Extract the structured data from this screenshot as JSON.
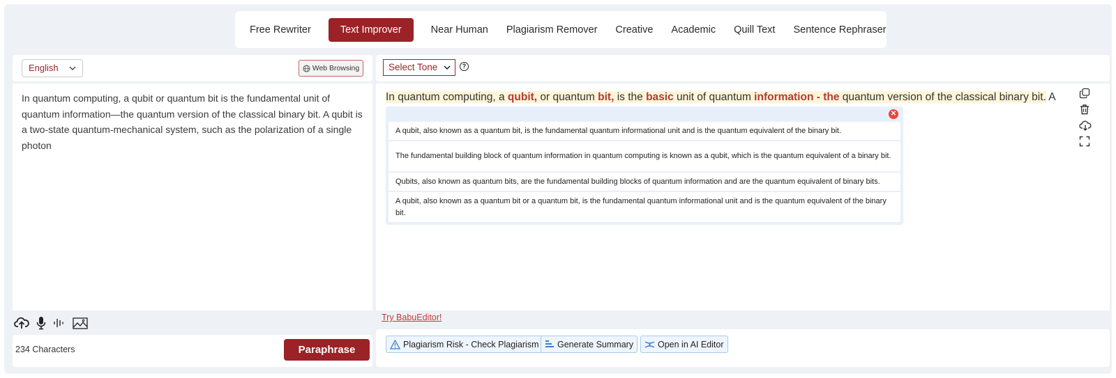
{
  "tabs": [
    {
      "label": "Free Rewriter",
      "active": false
    },
    {
      "label": "Text Improver",
      "active": true
    },
    {
      "label": "Near Human",
      "active": false
    },
    {
      "label": "Plagiarism Remover",
      "active": false
    },
    {
      "label": "Creative",
      "active": false
    },
    {
      "label": "Academic",
      "active": false
    },
    {
      "label": "Quill Text",
      "active": false
    },
    {
      "label": "Sentence Rephraser",
      "active": false
    }
  ],
  "input_panel": {
    "language": "English",
    "web_browsing_label": "Web Browsing",
    "text": "In quantum computing, a qubit or quantum bit is the fundamental unit of quantum information—the quantum version of the classical binary bit. A qubit is a two-state quantum-mechanical system, such as the polarization of a single photon",
    "char_count": "234 Characters",
    "paraphrase_label": "Paraphrase"
  },
  "output_panel": {
    "tone_label": "Select Tone",
    "help_glyph": "?",
    "segments": [
      {
        "text": "In quantum computing, a ",
        "bold": false
      },
      {
        "text": "qubit,",
        "bold": true
      },
      {
        "text": " or quantum ",
        "bold": false
      },
      {
        "text": "bit,",
        "bold": true
      },
      {
        "text": " is the ",
        "bold": false
      },
      {
        "text": "basic",
        "bold": true
      },
      {
        "text": " unit of quantum ",
        "bold": false
      },
      {
        "text": "information - the",
        "bold": true
      },
      {
        "text": " quantum version of the classical binary bit.",
        "bold": false
      }
    ],
    "trailing_text": " A",
    "close_glyph": "✕",
    "suggestions": [
      "A qubit, also known as a quantum bit, is the fundamental quantum informational unit and is the quantum equivalent of the binary bit.",
      "The fundamental building block of quantum information in quantum computing is known as a qubit, which is the quantum equivalent of a binary bit.",
      "Qubits, also known as quantum bits, are the fundamental building blocks of quantum information and are the quantum equivalent of binary bits.",
      "A qubit, also known as a quantum bit or a quantum bit, is the fundamental quantum informational unit and is the quantum equivalent of the binary bit."
    ],
    "try_link": "Try BabuEditor!",
    "actions": [
      {
        "label": "Plagiarism Risk - Check Plagiarism",
        "icon": "warning-icon"
      },
      {
        "label": "Generate Summary",
        "icon": "summary-icon"
      },
      {
        "label": "Open in AI Editor",
        "icon": "ai-editor-icon"
      }
    ]
  },
  "colors": {
    "brand": "#9b2226",
    "highlight": "#fdf5d9",
    "changed_word": "#b33a3a",
    "suggestion_bg": "#e7f0fa"
  }
}
